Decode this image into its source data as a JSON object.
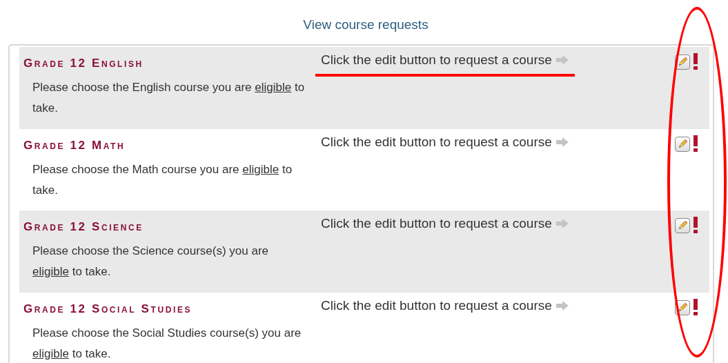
{
  "heading": "View course requests",
  "icons_circled": true,
  "rows": [
    {
      "title": "Grade 12 English",
      "desc_before": "Please choose the English course you are ",
      "link": "eligible",
      "desc_after": " to take.",
      "prompt": "Click the edit button to request a course",
      "shaded": true,
      "underlined": true,
      "required": true
    },
    {
      "title": "Grade 12 Math",
      "desc_before": "Please choose the Math course you are ",
      "link": "eligible",
      "desc_after": " to take.",
      "prompt": "Click the edit button to request a course",
      "shaded": false,
      "underlined": false,
      "required": true
    },
    {
      "title": "Grade 12 Science",
      "desc_before": "Please choose the Science course(s) you are ",
      "link": "eligible",
      "desc_after": " to take.",
      "prompt": "Click the edit button to request a course",
      "shaded": true,
      "underlined": false,
      "required": true
    },
    {
      "title": "Grade 12 Social Studies",
      "desc_before": "Please choose the Social Studies course(s) you are ",
      "link": "eligible",
      "desc_after": " to take.",
      "prompt": "Click the edit button to request a course",
      "shaded": false,
      "underlined": false,
      "required": true
    }
  ]
}
